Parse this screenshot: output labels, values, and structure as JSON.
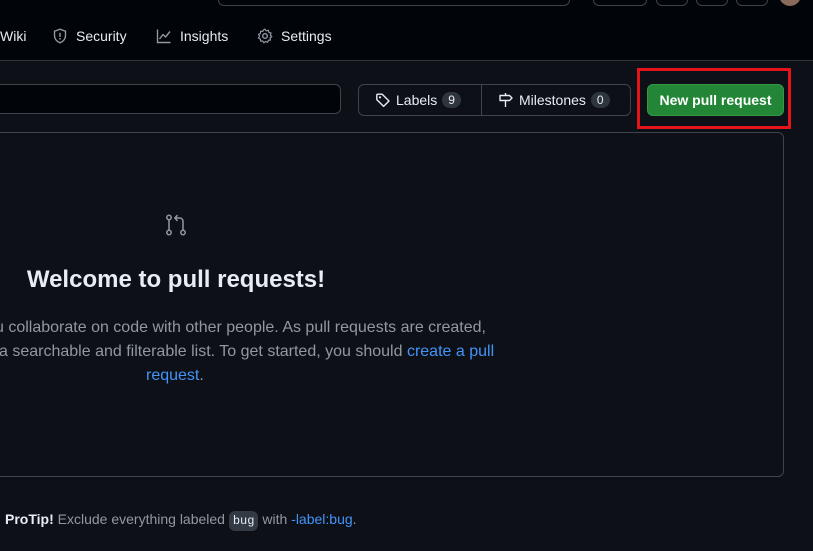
{
  "nav": {
    "wiki": "Wiki",
    "security": "Security",
    "insights": "Insights",
    "settings": "Settings"
  },
  "filters": {
    "labels_label": "Labels",
    "labels_count": "9",
    "milestones_label": "Milestones",
    "milestones_count": "0"
  },
  "new_pr_button": "New pull request",
  "blank_state": {
    "title": "Welcome to pull requests!",
    "line1": "u collaborate on code with other people. As pull requests are created,",
    "line2_text": "a searchable and filterable list. To get started, you should ",
    "line2_link": "create a pull",
    "line3_link": "request",
    "line3_end": "."
  },
  "protip": {
    "label": "ProTip!",
    "text1": " Exclude everything labeled ",
    "code": "bug",
    "text2": " with ",
    "link": "-label:bug",
    "end": "."
  },
  "colors": {
    "background": "#0d1117",
    "primary_button": "#238636",
    "link": "#4493f8",
    "highlight_box": "#e5131a"
  }
}
